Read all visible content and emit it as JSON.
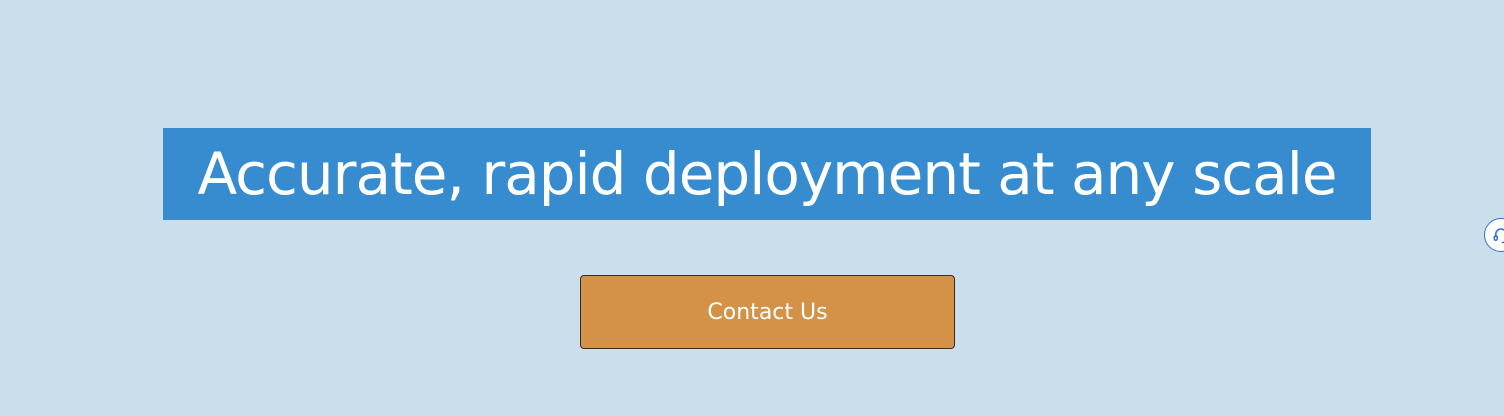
{
  "hero": {
    "headline": "Accurate, rapid deployment at any scale",
    "cta_label": "Contact Us"
  },
  "chat_widget": {
    "icon": "headset-icon"
  },
  "colors": {
    "background": "#cbdeec",
    "headline_highlight": "#378ccf",
    "cta_background": "#d49248",
    "chat_border": "#2e74d0"
  }
}
